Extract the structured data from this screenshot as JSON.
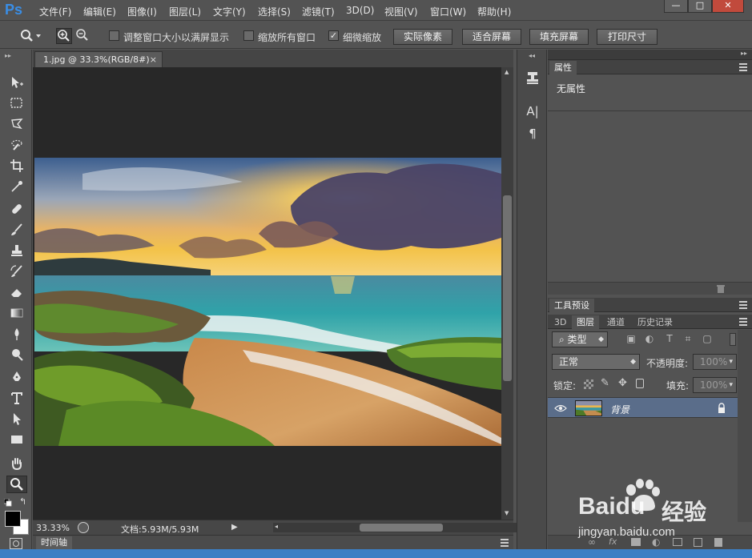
{
  "app": {
    "logo_text": "Ps"
  },
  "menu": [
    {
      "label": "文件(F)"
    },
    {
      "label": "编辑(E)"
    },
    {
      "label": "图像(I)"
    },
    {
      "label": "图层(L)"
    },
    {
      "label": "文字(Y)"
    },
    {
      "label": "选择(S)"
    },
    {
      "label": "滤镜(T)"
    },
    {
      "label": "3D(D)"
    },
    {
      "label": "视图(V)"
    },
    {
      "label": "窗口(W)"
    },
    {
      "label": "帮助(H)"
    }
  ],
  "window_controls": {
    "minimize": "—",
    "maximize": "□",
    "close": "✕"
  },
  "options": {
    "resize_windows_label": "调整窗口大小以满屏显示",
    "resize_windows_checked": false,
    "zoom_all_label": "缩放所有窗口",
    "zoom_all_checked": false,
    "scrubby_zoom_label": "细微缩放",
    "scrubby_zoom_checked": true,
    "actual_pixels": "实际像素",
    "fit_screen": "适合屏幕",
    "fill_screen": "填充屏幕",
    "print_size": "打印尺寸"
  },
  "document": {
    "tab_title": "1.jpg @ 33.3%(RGB/8#)",
    "tab_close": "×",
    "zoom": "33.33%",
    "info": "文档:5.93M/5.93M"
  },
  "timeline": {
    "label": "时间轴"
  },
  "properties": {
    "tab": "属性",
    "empty_text": "无属性"
  },
  "tool_presets": {
    "tab": "工具预设"
  },
  "layers_panel": {
    "tabs": [
      "3D",
      "图层",
      "通道",
      "历史记录"
    ],
    "active_tab": "图层",
    "filter_kind": "类型",
    "blend_mode": "正常",
    "opacity_label": "不透明度:",
    "opacity_value": "100%",
    "lock_label": "锁定:",
    "fill_label": "填充:",
    "fill_value": "100%",
    "layers": [
      {
        "name": "背景",
        "visible": true,
        "locked": true
      }
    ]
  },
  "watermark": {
    "brand": "Baidu",
    "brand_cn": "经验",
    "url": "jingyan.baidu.com"
  },
  "colors": {
    "ui_bg": "#535353",
    "canvas_bg": "#282828",
    "selected_layer": "#5a6d8a",
    "ps_blue": "#3a8ee6"
  }
}
